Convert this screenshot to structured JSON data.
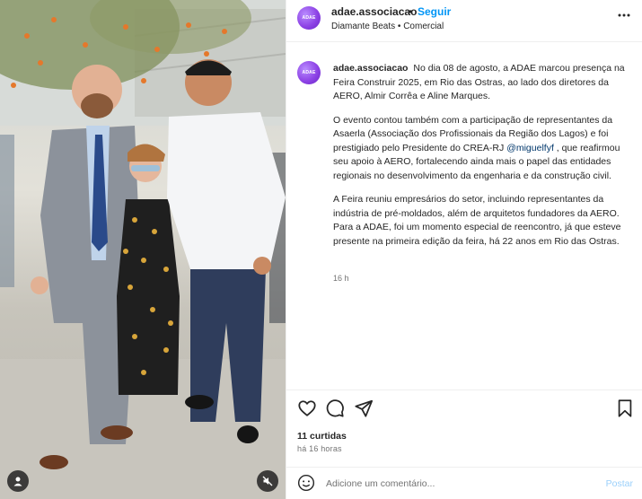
{
  "post": {
    "username": "adae.associacao",
    "separator": "•",
    "follow_label": "Seguir",
    "subtitle": "Diamante Beats • Comercial",
    "avatar_text": "ADAE",
    "caption": {
      "username": "adae.associacao",
      "paragraph_1": "No dia 08 de agosto, a ADAE marcou presença na Feira Construir 2025, em Rio das Ostras, ao lado dos diretores da AERO, Almir Corrêa e Aline Marques.",
      "paragraph_2_before": "O evento contou também com a participação de representantes da Asaerla (Associação dos Profissionais da Região dos Lagos) e foi prestigiado pelo Presidente do CREA-RJ ",
      "mention": "@miguelfyf",
      "paragraph_2_after": " , que reafirmou seu apoio à AERO, fortalecendo ainda mais o papel das entidades regionais no desenvolvimento da engenharia e da construção civil.",
      "paragraph_3": "A Feira reuniu empresários do setor, incluindo representantes da indústria de pré-moldados, além de arquitetos fundadores da AERO. Para a ADAE, foi um momento especial de reencontro, já que esteve presente na primeira edição da feira, há 22 anos em Rio das Ostras."
    },
    "caption_time": "16 h",
    "likes": "11 curtidas",
    "time_ago": "há 16 horas",
    "comment_placeholder": "Adicione um comentário...",
    "post_button": "Postar"
  },
  "icons": {
    "more": "more-options-icon",
    "like": "heart-icon",
    "comment": "comment-bubble-icon",
    "share": "paper-plane-icon",
    "save": "bookmark-icon",
    "emoji": "smiley-icon",
    "photo_tags": "user-tag-icon",
    "photo_mute": "mute-icon"
  },
  "colors": {
    "accent": "#0095f6",
    "mention": "#00376b",
    "secondary_text": "#737373",
    "post_button_disabled": "#9bd0fb",
    "avatar": "#8e44e6"
  }
}
